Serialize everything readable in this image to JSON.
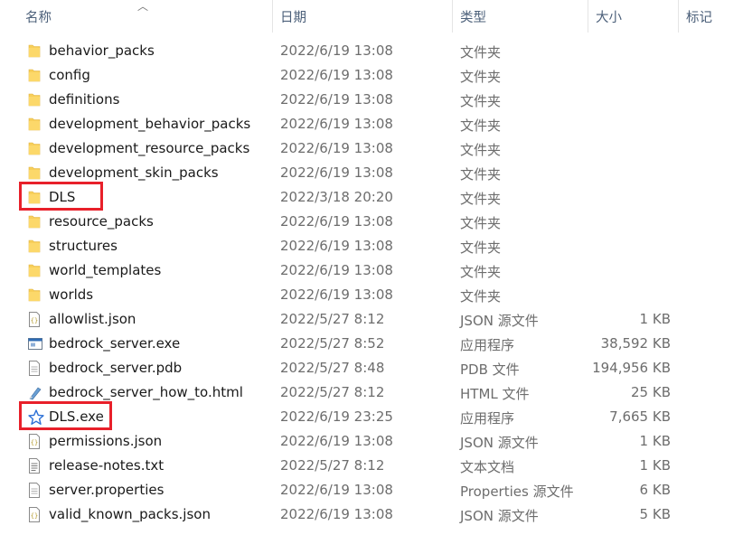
{
  "header": {
    "name": "名称",
    "date": "日期",
    "type": "类型",
    "size": "大小",
    "tags": "标记"
  },
  "files": [
    {
      "name": "behavior_packs",
      "date": "2022/6/19 13:08",
      "type": "文件夹",
      "size": "",
      "icon": "folder-icon"
    },
    {
      "name": "config",
      "date": "2022/6/19 13:08",
      "type": "文件夹",
      "size": "",
      "icon": "folder-icon"
    },
    {
      "name": "definitions",
      "date": "2022/6/19 13:08",
      "type": "文件夹",
      "size": "",
      "icon": "folder-icon"
    },
    {
      "name": "development_behavior_packs",
      "date": "2022/6/19 13:08",
      "type": "文件夹",
      "size": "",
      "icon": "folder-icon"
    },
    {
      "name": "development_resource_packs",
      "date": "2022/6/19 13:08",
      "type": "文件夹",
      "size": "",
      "icon": "folder-icon"
    },
    {
      "name": "development_skin_packs",
      "date": "2022/6/19 13:08",
      "type": "文件夹",
      "size": "",
      "icon": "folder-icon"
    },
    {
      "name": "DLS",
      "date": "2022/3/18 20:20",
      "type": "文件夹",
      "size": "",
      "icon": "folder-icon",
      "highlighted": true
    },
    {
      "name": "resource_packs",
      "date": "2022/6/19 13:08",
      "type": "文件夹",
      "size": "",
      "icon": "folder-icon"
    },
    {
      "name": "structures",
      "date": "2022/6/19 13:08",
      "type": "文件夹",
      "size": "",
      "icon": "folder-icon"
    },
    {
      "name": "world_templates",
      "date": "2022/6/19 13:08",
      "type": "文件夹",
      "size": "",
      "icon": "folder-icon"
    },
    {
      "name": "worlds",
      "date": "2022/6/19 13:08",
      "type": "文件夹",
      "size": "",
      "icon": "folder-icon"
    },
    {
      "name": "allowlist.json",
      "date": "2022/5/27 8:12",
      "type": "JSON 源文件",
      "size": "1 KB",
      "icon": "json-file-icon"
    },
    {
      "name": "bedrock_server.exe",
      "date": "2022/5/27 8:52",
      "type": "应用程序",
      "size": "38,592 KB",
      "icon": "exe-window-icon"
    },
    {
      "name": "bedrock_server.pdb",
      "date": "2022/5/27 8:48",
      "type": "PDB 文件",
      "size": "194,956 KB",
      "icon": "document-icon"
    },
    {
      "name": "bedrock_server_how_to.html",
      "date": "2022/5/27 8:12",
      "type": "HTML 文件",
      "size": "25 KB",
      "icon": "html-file-icon"
    },
    {
      "name": "DLS.exe",
      "date": "2022/6/19 23:25",
      "type": "应用程序",
      "size": "7,665 KB",
      "icon": "star-app-icon",
      "highlighted": true
    },
    {
      "name": "permissions.json",
      "date": "2022/6/19 13:08",
      "type": "JSON 源文件",
      "size": "1 KB",
      "icon": "json-file-icon"
    },
    {
      "name": "release-notes.txt",
      "date": "2022/5/27 8:12",
      "type": "文本文档",
      "size": "1 KB",
      "icon": "text-file-icon"
    },
    {
      "name": "server.properties",
      "date": "2022/6/19 13:08",
      "type": "Properties 源文件",
      "size": "6 KB",
      "icon": "document-icon"
    },
    {
      "name": "valid_known_packs.json",
      "date": "2022/6/19 13:08",
      "type": "JSON 源文件",
      "size": "5 KB",
      "icon": "json-file-icon"
    }
  ],
  "colors": {
    "highlight": "#e8202a",
    "folder": "#f8cf5a",
    "header_text": "#4c607a"
  }
}
